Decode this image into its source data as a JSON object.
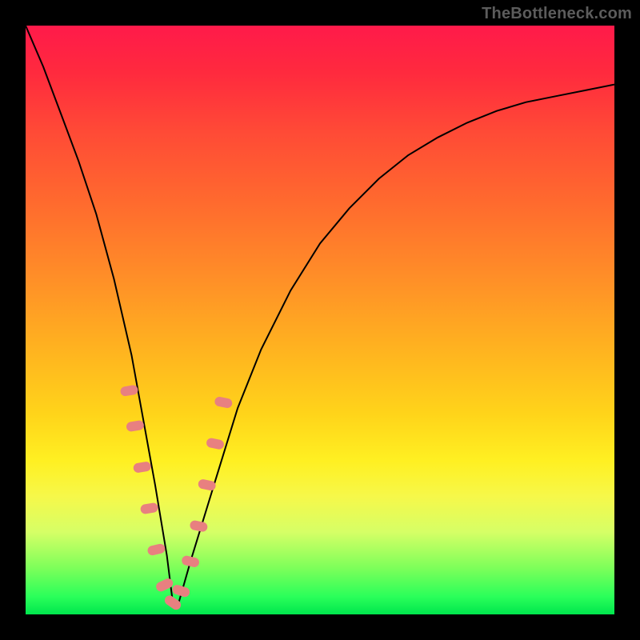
{
  "watermark": {
    "text": "TheBottleneck.com"
  },
  "gradient_colors": [
    "#ff1a4a",
    "#ff2a3e",
    "#ff4a36",
    "#ff6a2e",
    "#ff8c28",
    "#ffb020",
    "#ffd41a",
    "#fff022",
    "#f6f84a",
    "#d6ff66",
    "#7fff5a",
    "#2aff5a",
    "#00e64d"
  ],
  "chart_data": {
    "type": "line",
    "title": "",
    "xlabel": "",
    "ylabel": "",
    "xlim": [
      0,
      1
    ],
    "ylim": [
      0,
      100
    ],
    "note": "No axis ticks or labels are rendered in the source image; x values are normalized positions and y values are the curve height as a percentage of the plot height (0 = bottom/green, 100 = top/red).",
    "series": [
      {
        "name": "bottleneck-curve",
        "x": [
          0.0,
          0.03,
          0.06,
          0.09,
          0.12,
          0.15,
          0.18,
          0.2,
          0.22,
          0.24,
          0.25,
          0.26,
          0.28,
          0.32,
          0.36,
          0.4,
          0.45,
          0.5,
          0.55,
          0.6,
          0.65,
          0.7,
          0.75,
          0.8,
          0.85,
          0.9,
          0.95,
          1.0
        ],
        "y": [
          100,
          93,
          85,
          77,
          68,
          57,
          44,
          33,
          22,
          10,
          2,
          2,
          9,
          22,
          35,
          45,
          55,
          63,
          69,
          74,
          78,
          81,
          83.5,
          85.5,
          87,
          88,
          89,
          90
        ]
      }
    ],
    "markers": {
      "name": "highlight-beads",
      "shape": "rounded-rect",
      "color": "#e88080",
      "points_x": [
        0.176,
        0.186,
        0.198,
        0.21,
        0.222,
        0.236,
        0.25,
        0.264,
        0.28,
        0.294,
        0.308,
        0.322,
        0.336
      ],
      "points_y": [
        38,
        32,
        25,
        18,
        11,
        5,
        2,
        4,
        9,
        15,
        22,
        29,
        36
      ]
    }
  }
}
